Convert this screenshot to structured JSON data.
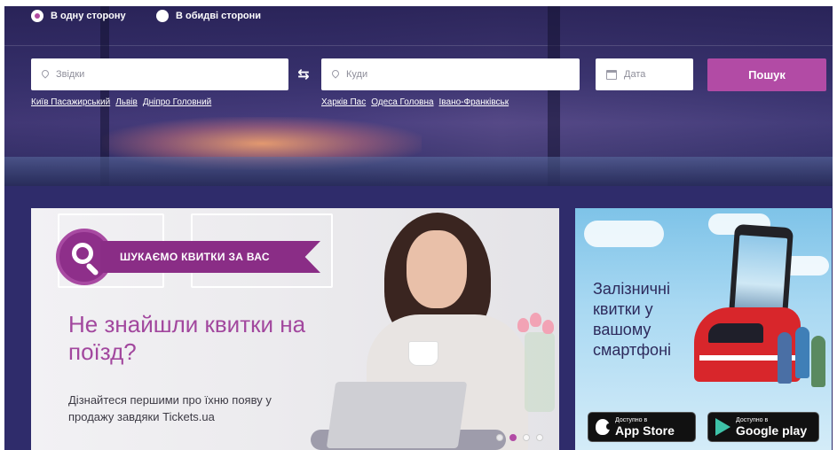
{
  "trip_type": {
    "one_way_label": "В одну сторону",
    "round_trip_label": "В обидві сторони",
    "selected": "one_way"
  },
  "search": {
    "from_placeholder": "Звідки",
    "to_placeholder": "Куди",
    "date_placeholder": "Дата",
    "submit_label": "Пошук",
    "from_quick_links": [
      "Київ Пасажирський",
      "Львів",
      "Дніпро Головний"
    ],
    "to_quick_links": [
      "Харків Пас",
      "Одеса Головна",
      "Івано-Франківськ"
    ]
  },
  "promo": {
    "ribbon": "ШУКАЄМО КВИТКИ ЗА ВАС",
    "headline": "Не знайшли квитки на поїзд?",
    "subtext": "Дізнайтеся першими про їхню появу у продажу завдяки Tickets.ua",
    "slides_count": 4,
    "active_slide": 2
  },
  "app_promo": {
    "title": "Залізничні квитки у вашому смартфоні",
    "app_store": {
      "small": "Доступно в",
      "large": "App Store"
    },
    "google_play": {
      "small": "Доступно в",
      "large": "Google play"
    }
  },
  "colors": {
    "accent": "#b24ba5",
    "hero_dark": "#2f2c6b",
    "promo_purple": "#8a2d86"
  },
  "icons": [
    "radio-icon",
    "location-pin-icon",
    "swap-arrows-icon",
    "calendar-icon",
    "search-magnifier-icon",
    "apple-icon",
    "google-play-icon"
  ]
}
